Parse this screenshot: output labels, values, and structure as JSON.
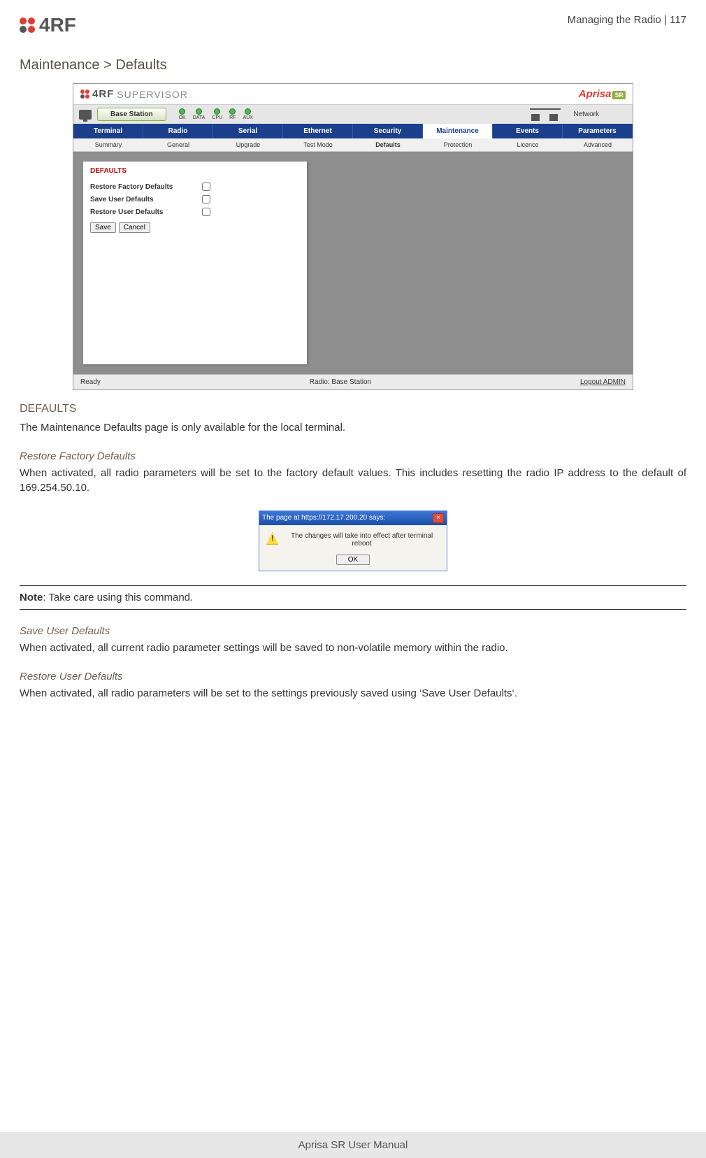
{
  "header": {
    "logo_text": "4RF",
    "right": "Managing the Radio  |  117"
  },
  "title": "Maintenance > Defaults",
  "supervisor": {
    "logo_brand": "4RF",
    "logo_sub": "SUPERVISOR",
    "product": "Aprisa",
    "product_badge": "SR",
    "base_station_btn": "Base Station",
    "network_label": "Network",
    "leds": [
      {
        "label": "OK"
      },
      {
        "label": "DATA"
      },
      {
        "label": "CPU"
      },
      {
        "label": "RF"
      },
      {
        "label": "AUX"
      }
    ],
    "tabs": [
      "Terminal",
      "Radio",
      "Serial",
      "Ethernet",
      "Security",
      "Maintenance",
      "Events",
      "Parameters"
    ],
    "active_tab": "Maintenance",
    "subtabs": [
      "Summary",
      "General",
      "Upgrade",
      "Test Mode",
      "Defaults",
      "Protection",
      "Licence",
      "Advanced"
    ],
    "active_subtab": "Defaults",
    "panel_title": "DEFAULTS",
    "rows": {
      "r1": "Restore Factory Defaults",
      "r2": "Save User Defaults",
      "r3": "Restore User Defaults"
    },
    "save_btn": "Save",
    "cancel_btn": "Cancel",
    "status_left": "Ready",
    "status_mid": "Radio: Base Station",
    "status_right": "Logout ADMIN"
  },
  "sections": {
    "defaults_h": "DEFAULTS",
    "defaults_p": "The Maintenance Defaults page is only available for the local terminal.",
    "rfd_h": "Restore Factory Defaults",
    "rfd_p": "When activated, all radio parameters will be set to the factory default values. This includes resetting the radio IP address to the default of 169.254.50.10.",
    "note": "Note",
    "note_text": ": Take care using this command.",
    "sud_h": "Save User Defaults",
    "sud_p": "When activated, all current radio parameter settings will be saved to non-volatile memory within the radio.",
    "rud_h": "Restore User Defaults",
    "rud_p": "When activated, all radio parameters will be set to the settings previously saved using ‘Save User Defaults‘."
  },
  "dialog": {
    "title": "The page at https://172.17.200.20 says:",
    "body": "The changes will take into effect after terminal reboot",
    "ok": "OK"
  },
  "footer": "Aprisa SR User Manual"
}
